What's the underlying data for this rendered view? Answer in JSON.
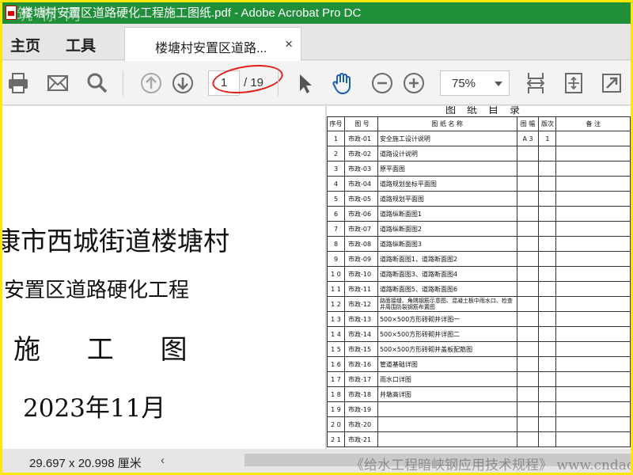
{
  "window": {
    "title": "楼塘村安置区道路硬化工程施工图纸.pdf - Adobe Acrobat Pro DC",
    "watermark_top": "筑 标 网"
  },
  "menu": {
    "home": "主页",
    "tools": "工具"
  },
  "tab": {
    "label": "楼塘村安置区道路...",
    "close": "×"
  },
  "toolbar": {
    "icons": [
      "print-icon",
      "email-icon",
      "search-icon",
      "prev-page-icon",
      "next-page-icon",
      "select-pointer-icon",
      "hand-tool-icon",
      "zoom-out-icon",
      "zoom-in-icon",
      "fit-width-icon",
      "full-page-icon",
      "fullscreen-icon"
    ],
    "page_current": "1",
    "page_total": "/ 19",
    "zoom": "75%"
  },
  "cover": {
    "line1": "康市西城街道楼塘村",
    "line2": "安置区道路硬化工程",
    "line3": "施 工 图",
    "line4": "2023年11月"
  },
  "catalog": {
    "title": "图纸目录",
    "headers": [
      "序号",
      "图 号",
      "图 纸 名 称",
      "图 幅",
      "版次",
      "备 注"
    ],
    "rows": [
      {
        "no": "1",
        "code": "市政-01",
        "name": "安全施工设计说明",
        "size": "A 3",
        "ver": "1"
      },
      {
        "no": "2",
        "code": "市政-02",
        "name": "道路设计说明",
        "size": "",
        "ver": ""
      },
      {
        "no": "3",
        "code": "市政-03",
        "name": "原平面图",
        "size": "",
        "ver": ""
      },
      {
        "no": "4",
        "code": "市政-04",
        "name": "道路规划坐标平面图",
        "size": "",
        "ver": ""
      },
      {
        "no": "5",
        "code": "市政-05",
        "name": "道路规划平面图",
        "size": "",
        "ver": ""
      },
      {
        "no": "6",
        "code": "市政-06",
        "name": "道路纵断面图1",
        "size": "",
        "ver": ""
      },
      {
        "no": "7",
        "code": "市政-07",
        "name": "道路纵断面图2",
        "size": "",
        "ver": ""
      },
      {
        "no": "8",
        "code": "市政-08",
        "name": "道路纵断面图3",
        "size": "",
        "ver": ""
      },
      {
        "no": "9",
        "code": "市政-09",
        "name": "道路断面图1、道路断面图2",
        "size": "",
        "ver": ""
      },
      {
        "no": "1 0",
        "code": "市政-10",
        "name": "道路断面图3、道路断面图4",
        "size": "",
        "ver": ""
      },
      {
        "no": "1 1",
        "code": "市政-11",
        "name": "道路断面图5、道路断面图6",
        "size": "",
        "ver": ""
      },
      {
        "no": "1 2",
        "code": "市政-12",
        "name": "路面接缝、角隅钢筋示意图、混凝土板中雨水口、检查井周围防裂钢筋布置图",
        "size": "",
        "ver": ""
      },
      {
        "no": "1 3",
        "code": "市政-13",
        "name": "500×500方形砖砌井详图一",
        "size": "",
        "ver": ""
      },
      {
        "no": "1 4",
        "code": "市政-14",
        "name": "500×500方形砖砌井详图二",
        "size": "",
        "ver": ""
      },
      {
        "no": "1 5",
        "code": "市政-15",
        "name": "500×500方形砖砌井盖板配筋图",
        "size": "",
        "ver": ""
      },
      {
        "no": "1 6",
        "code": "市政-16",
        "name": "管道基础详图",
        "size": "",
        "ver": ""
      },
      {
        "no": "1 7",
        "code": "市政-17",
        "name": "雨水口详图",
        "size": "",
        "ver": ""
      },
      {
        "no": "1 8",
        "code": "市政-18",
        "name": "井墩高详图",
        "size": "",
        "ver": ""
      },
      {
        "no": "1 9",
        "code": "市政-19",
        "name": "",
        "size": "",
        "ver": ""
      },
      {
        "no": "2 0",
        "code": "市政-20",
        "name": "",
        "size": "",
        "ver": ""
      },
      {
        "no": "2 1",
        "code": "市政-21",
        "name": "",
        "size": "",
        "ver": ""
      }
    ]
  },
  "status": {
    "dimensions": "29.697 x 20.998 厘米",
    "scroll_left": "‹",
    "watermark_bottom": "《给水工程暗峡钢应用技术规程》 www.cndao.com 总见辆"
  },
  "colors": {
    "titlebar": "#1f8f3a",
    "outer_border": "#ffe800",
    "annotation_circle": "#e0201b",
    "toolbar_icon": "#6b6b6b",
    "hand_tool": "#1a5fb4"
  }
}
